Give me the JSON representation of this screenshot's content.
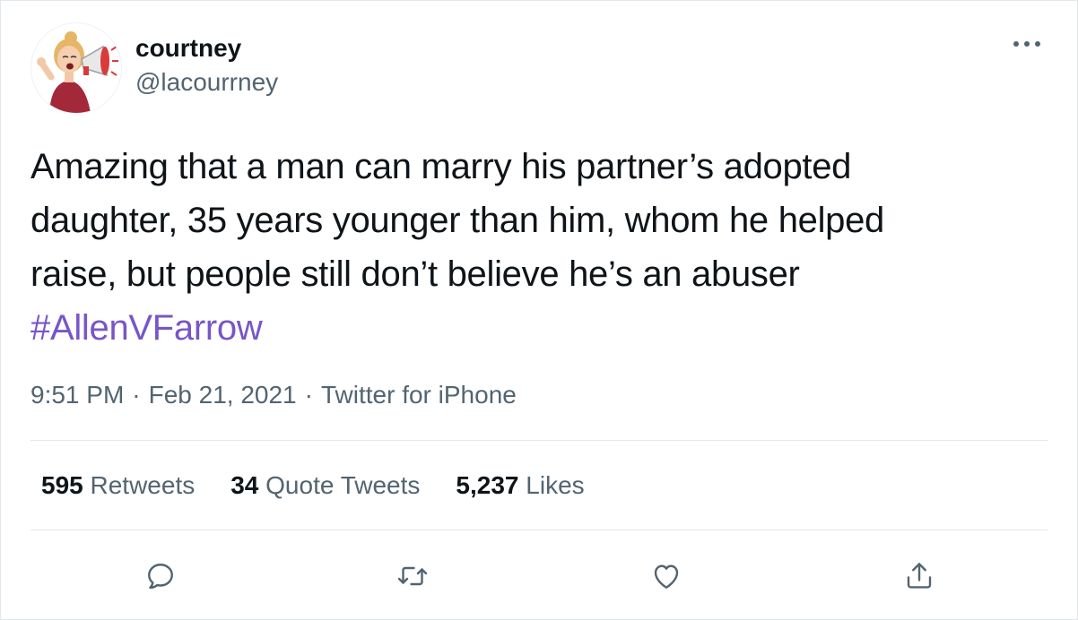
{
  "author": {
    "name": "courtney",
    "handle": "@lacourrney",
    "avatar_icon": "memoji-megaphone-avatar"
  },
  "tweet": {
    "lines": [
      "Amazing that a man can marry his partner’s adopted",
      "daughter, 35 years younger than him, whom he helped",
      "raise, but people still don’t believe he’s an abuser"
    ],
    "hashtag": "#AllenVFarrow"
  },
  "meta": {
    "time": "9:51 PM",
    "date": "Feb 21, 2021",
    "source": "Twitter for iPhone",
    "separator": "·"
  },
  "stats": {
    "retweets_count": "595",
    "retweets_label": "Retweets",
    "quotes_count": "34",
    "quotes_label": "Quote Tweets",
    "likes_count": "5,237",
    "likes_label": "Likes"
  },
  "actions": [
    "reply-icon",
    "retweet-icon",
    "like-icon",
    "share-icon"
  ],
  "colors": {
    "text": "#0f1419",
    "muted": "#536471",
    "hashtag": "#7856c9",
    "border": "#e1e8ed"
  }
}
